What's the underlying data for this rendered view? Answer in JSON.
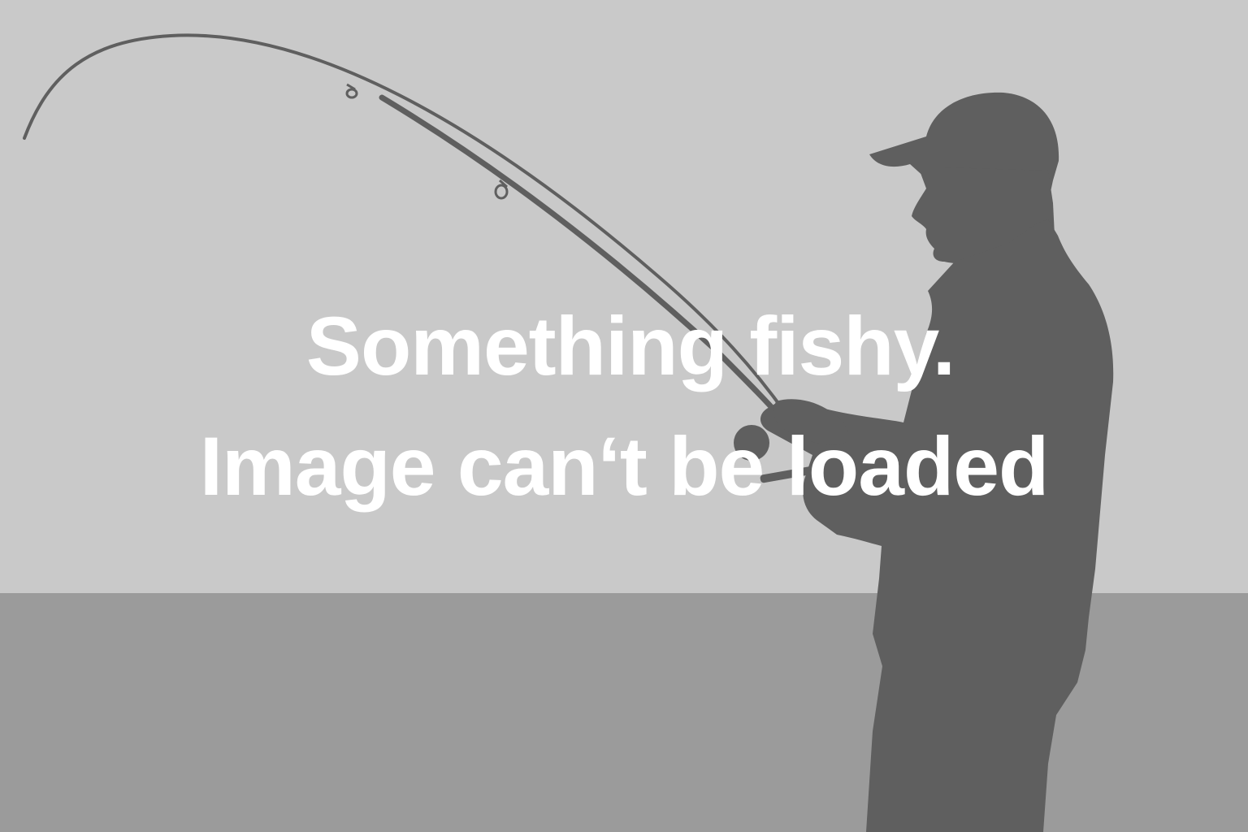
{
  "error": {
    "headline": "Something fishy.",
    "detail": "Image can‘t be loaded"
  },
  "illustration": {
    "subject": "angler-silhouette",
    "icons": [
      "fishing-rod-icon",
      "angler-silhouette-icon",
      "fishing-reel-icon"
    ]
  },
  "colors": {
    "sky": "#c9c9c9",
    "ground": "#9b9b9b",
    "silhouette": "#5f5f5f",
    "text": "#ffffff"
  }
}
